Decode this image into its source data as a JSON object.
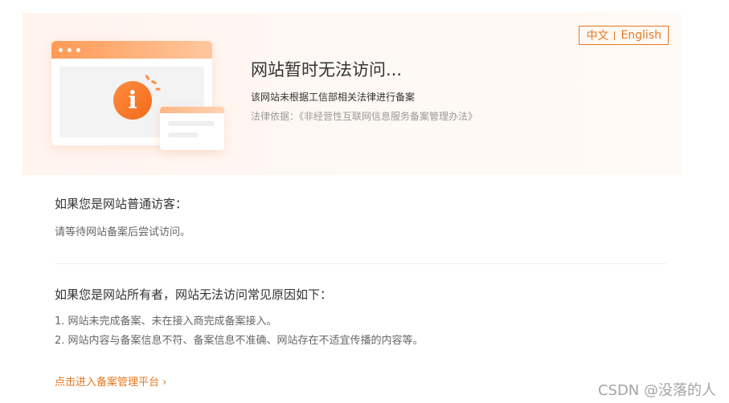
{
  "language_switch": {
    "chinese": "中文",
    "english": "English"
  },
  "hero": {
    "title": "网站暂时无法访问...",
    "subtitle": "该网站未根据工信部相关法律进行备案",
    "law_basis": "法律依据：《非经营性互联网信息服务备案管理办法》",
    "icon": "info-icon",
    "accent_color": "#e8771f"
  },
  "visitor_section": {
    "heading": "如果您是网站普通访客：",
    "text": "请等待网站备案后尝试访问。"
  },
  "owner_section": {
    "heading": "如果您是网站所有者，网站无法访问常见原因如下：",
    "reasons": [
      "1. 网站未完成备案、未在接入商完成备案接入。",
      "2. 网站内容与备案信息不符、备案信息不准确、网站存在不适宜传播的内容等。"
    ]
  },
  "manage_link": {
    "label": "点击进入备案管理平台",
    "arrow": "›"
  },
  "watermark": "CSDN @没落的人"
}
